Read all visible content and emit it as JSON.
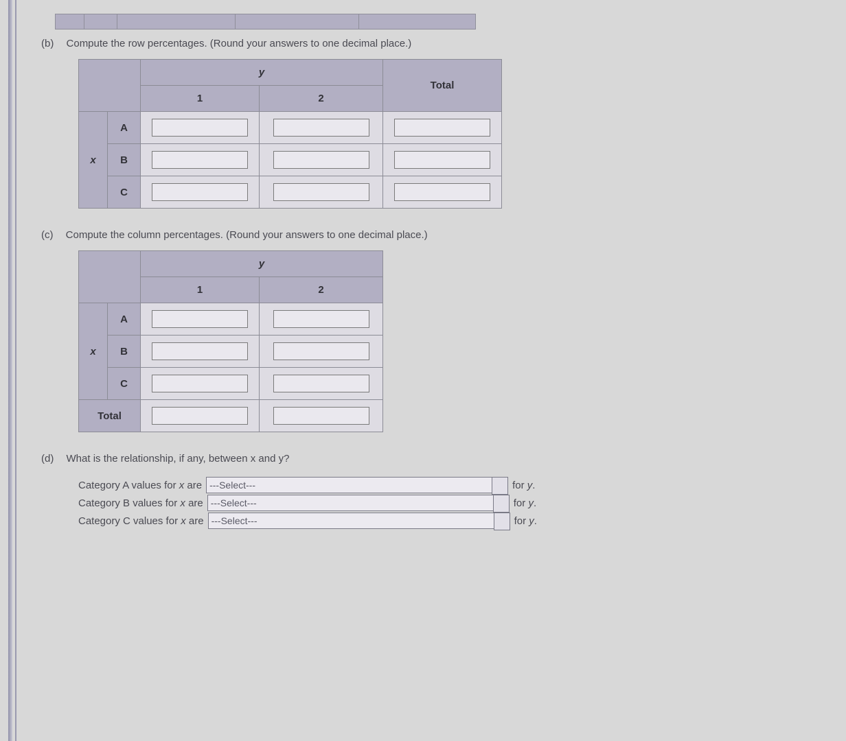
{
  "part_b": {
    "label": "(b)",
    "prompt": "Compute the row percentages. (Round your answers to one decimal place.)",
    "y_header": "y",
    "col1": "1",
    "col2": "2",
    "total": "Total",
    "x_header": "x",
    "rows": {
      "a": "A",
      "b": "B",
      "c": "C"
    }
  },
  "part_c": {
    "label": "(c)",
    "prompt": "Compute the column percentages. (Round your answers to one decimal place.)",
    "y_header": "y",
    "col1": "1",
    "col2": "2",
    "x_header": "x",
    "rows": {
      "a": "A",
      "b": "B",
      "c": "C"
    },
    "total_row": "Total"
  },
  "part_d": {
    "label": "(d)",
    "prompt": "What is the relationship, if any, between x and y?",
    "lines": [
      {
        "pre1": "Category A values for ",
        "var": "x",
        "pre2": " are",
        "select": "---Select---",
        "post1": "for ",
        "post_var": "y",
        "post2": "."
      },
      {
        "pre1": "Category B values for ",
        "var": "x",
        "pre2": " are",
        "select": "---Select---",
        "post1": "for ",
        "post_var": "y",
        "post2": "."
      },
      {
        "pre1": "Category C values for ",
        "var": "x",
        "pre2": " are",
        "select": "---Select---",
        "post1": "for ",
        "post_var": "y",
        "post2": "."
      }
    ]
  }
}
